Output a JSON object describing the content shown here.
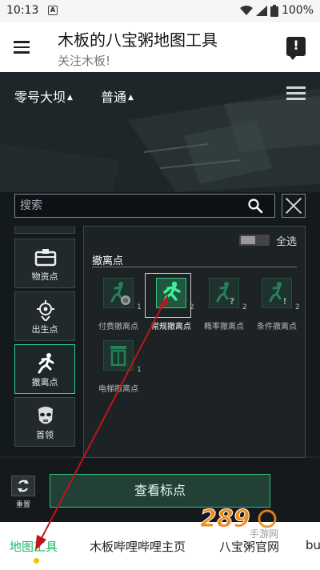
{
  "status_bar": {
    "time": "10:13",
    "notification_icon": "A",
    "battery": "100%"
  },
  "app_bar": {
    "title": "木板的八宝粥地图工具",
    "subtitle": "关注木板!",
    "feedback_icon": "!"
  },
  "map_controls": {
    "map_name": "零号大坝",
    "difficulty": "普通"
  },
  "search": {
    "placeholder": "搜索"
  },
  "categories": [
    {
      "label": "物资点",
      "icon": "supply-icon",
      "active": false
    },
    {
      "label": "出生点",
      "icon": "spawn-icon",
      "active": false
    },
    {
      "label": "撤离点",
      "icon": "evacuation-icon",
      "active": true
    },
    {
      "label": "首领",
      "icon": "boss-icon",
      "active": false
    }
  ],
  "item_panel": {
    "select_all_label": "全选",
    "section_title": "撤离点",
    "items": [
      {
        "label": "付费撤离点",
        "count": "1",
        "selected": false
      },
      {
        "label": "常规撤离点",
        "count": "2",
        "selected": true
      },
      {
        "label": "概率撤离点",
        "count": "2",
        "selected": false
      },
      {
        "label": "条件撤离点",
        "count": "2",
        "selected": false
      },
      {
        "label": "电梯撤离点",
        "count": "1",
        "selected": false
      }
    ]
  },
  "bottom": {
    "reset_label": "重置",
    "view_button": "查看标点"
  },
  "tabs": [
    {
      "label": "地图工具",
      "active": true
    },
    {
      "label": "木板哔哩哔哩主页",
      "active": false
    },
    {
      "label": "八宝粥官网",
      "active": false
    },
    {
      "label": "bu",
      "active": false
    }
  ],
  "watermark": {
    "text": "289",
    "sub": "手游网"
  },
  "colors": {
    "accent": "#1eb86a",
    "panel_green": "#37c184",
    "map_bg": "#1c2428",
    "arrow": "#c0141a"
  }
}
